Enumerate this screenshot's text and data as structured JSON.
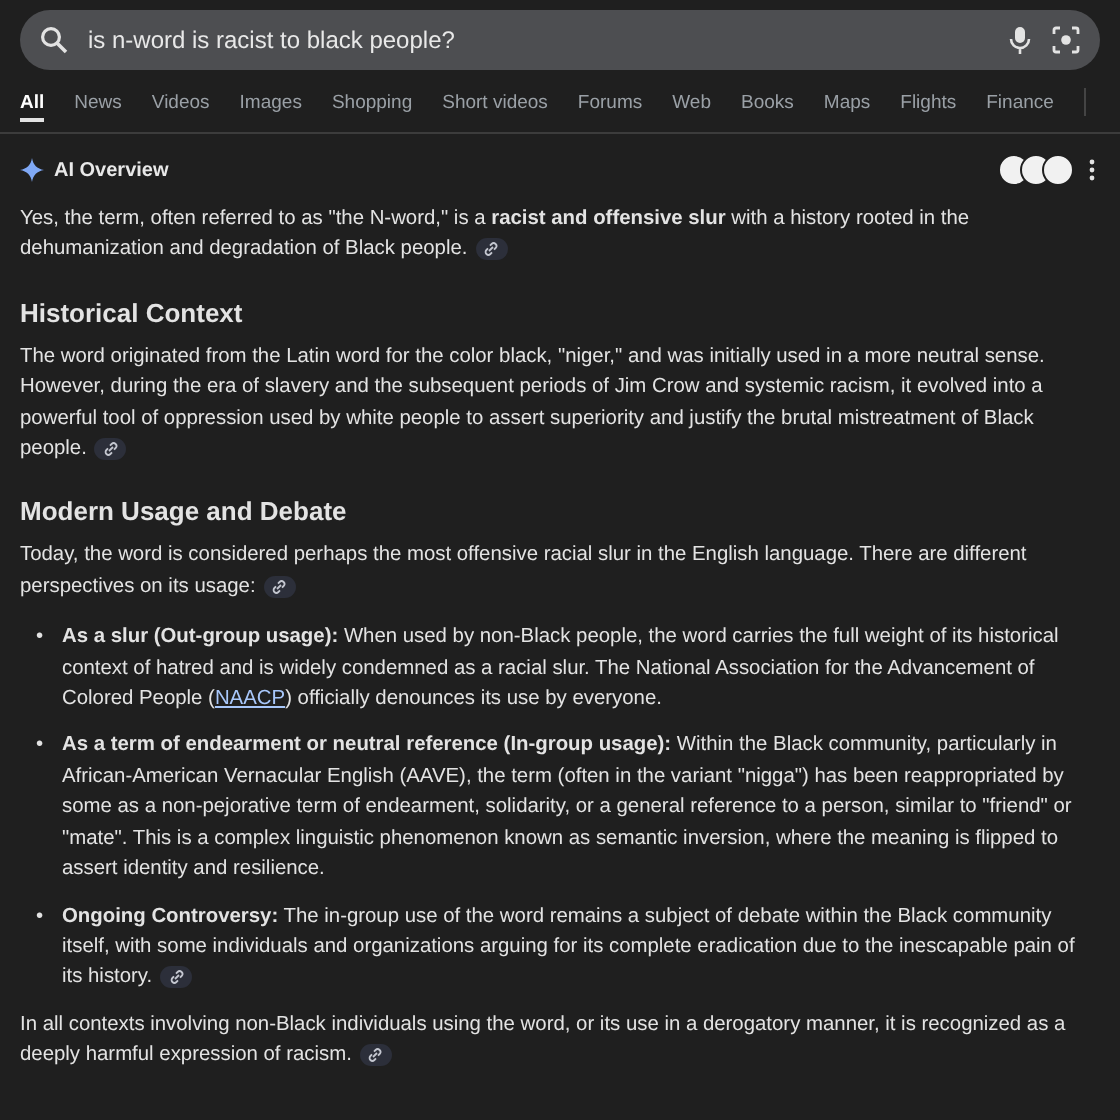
{
  "search": {
    "value": "is n-word is racist to black people?"
  },
  "tabs": [
    {
      "label": "All",
      "selected": true
    },
    {
      "label": "News",
      "selected": false
    },
    {
      "label": "Videos",
      "selected": false
    },
    {
      "label": "Images",
      "selected": false
    },
    {
      "label": "Shopping",
      "selected": false
    },
    {
      "label": "Short videos",
      "selected": false
    },
    {
      "label": "Forums",
      "selected": false
    },
    {
      "label": "Web",
      "selected": false
    },
    {
      "label": "Books",
      "selected": false
    },
    {
      "label": "Maps",
      "selected": false
    },
    {
      "label": "Flights",
      "selected": false
    },
    {
      "label": "Finance",
      "selected": false
    }
  ],
  "overview": {
    "title": "AI Overview",
    "blocks": [
      {
        "kind": "paragraph",
        "text": "Yes, the term, often referred to as \"the N-word,\" is a **racist and offensive slur** with a history rooted in the dehumanization and degradation of Black people.",
        "citation": true
      },
      {
        "kind": "heading",
        "text": "Historical Context"
      },
      {
        "kind": "paragraph",
        "text": "The word originated from the Latin word for the color black, \"niger,\" and was initially used in a more neutral sense. However, during the era of slavery and the subsequent periods of Jim Crow and systemic racism, it evolved into a powerful tool of oppression used by white people to assert superiority and justify the brutal mistreatment of Black people.",
        "citation": true
      },
      {
        "kind": "heading",
        "text": "Modern Usage and Debate"
      },
      {
        "kind": "paragraph",
        "text": "Today, the word is considered perhaps the most offensive racial slur in the English language. There are different perspectives on its usage:",
        "citation": true
      },
      {
        "kind": "bullets",
        "marker": "•",
        "items": [
          {
            "lead": "As a slur (Out-group usage):",
            "text": " When used by non-Black people, the word carries the full weight of its historical context of hatred and is widely condemned as a racial slur. The National Association for the Advancement of Colored People (",
            "link": "NAACP",
            "after": ") officially denounces its use by everyone.",
            "citation": false
          },
          {
            "lead": "As a term of endearment or neutral reference (In-group usage):",
            "text": " Within the Black community, particularly in African-American Vernacular English (AAVE), the term (often in the variant \"nigga\") has been reappropriated by some as a non-pejorative term of endearment, solidarity, or a general reference to a person, similar to \"friend\" or \"mate\". This is a complex linguistic phenomenon known as semantic inversion, where the meaning is flipped to assert identity and resilience.",
            "citation": false
          },
          {
            "lead": "Ongoing Controversy:",
            "text": " The in-group use of the word remains a subject of debate within the Black community itself, with some individuals and organizations arguing for its complete eradication due to the inescapable pain of its history.",
            "citation": true
          }
        ]
      },
      {
        "kind": "paragraph",
        "text": "In all contexts involving non-Black individuals using the word, or its use in a derogatory manner, it is recognized as a deeply harmful expression of racism.",
        "citation": true
      }
    ]
  }
}
